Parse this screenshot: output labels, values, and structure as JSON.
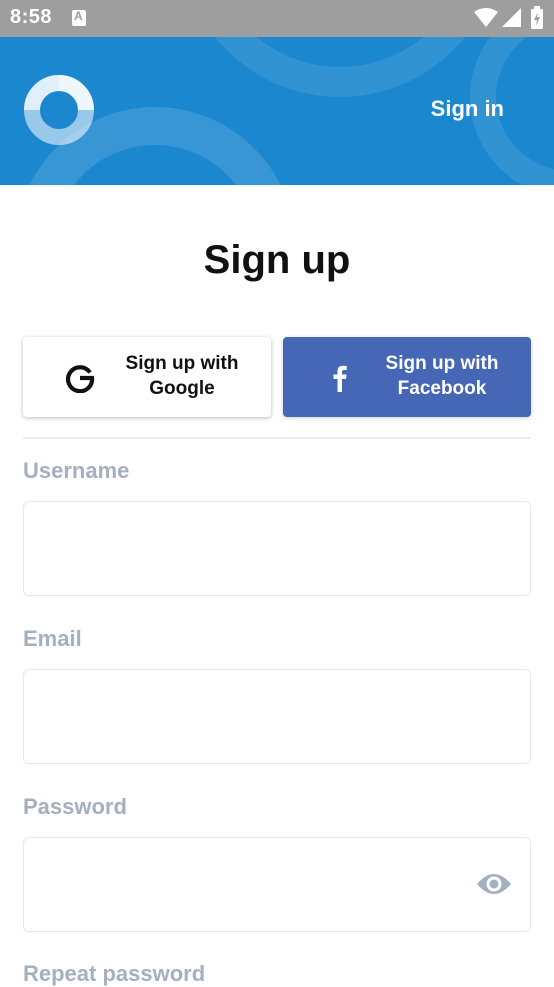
{
  "status_bar": {
    "time": "8:58",
    "icons": [
      "notification-a-icon",
      "wifi-icon",
      "signal-icon",
      "battery-icon"
    ]
  },
  "header": {
    "signin_label": "Sign in",
    "logo_icon": "ring-logo-icon",
    "background_color": "#1b87cf"
  },
  "main": {
    "title": "Sign up",
    "google_button": {
      "label_line1": "Sign up with",
      "label_line2": "Google",
      "icon": "google-g-icon"
    },
    "facebook_button": {
      "label_line1": "Sign up with",
      "label_line2": "Facebook",
      "icon": "facebook-f-icon",
      "color": "#4567b5"
    }
  },
  "form": {
    "username_label": "Username",
    "username_value": "",
    "email_label": "Email",
    "email_value": "",
    "password_label": "Password",
    "password_value": "",
    "password_toggle_icon": "eye-icon",
    "repeat_password_label": "Repeat password"
  }
}
